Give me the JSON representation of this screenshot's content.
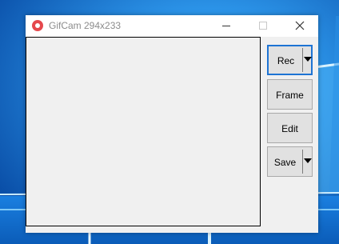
{
  "window": {
    "title": "GifCam 294x233",
    "icon": "camera-icon",
    "controls": [
      "minimize-icon",
      "maximize-icon",
      "close-icon"
    ]
  },
  "buttons": {
    "rec": "Rec",
    "frame": "Frame",
    "edit": "Edit",
    "save": "Save"
  },
  "colors": {
    "desktop_blue": "#0a6fd6",
    "accent_border": "#1e74d4",
    "icon_red": "#e5484d"
  }
}
